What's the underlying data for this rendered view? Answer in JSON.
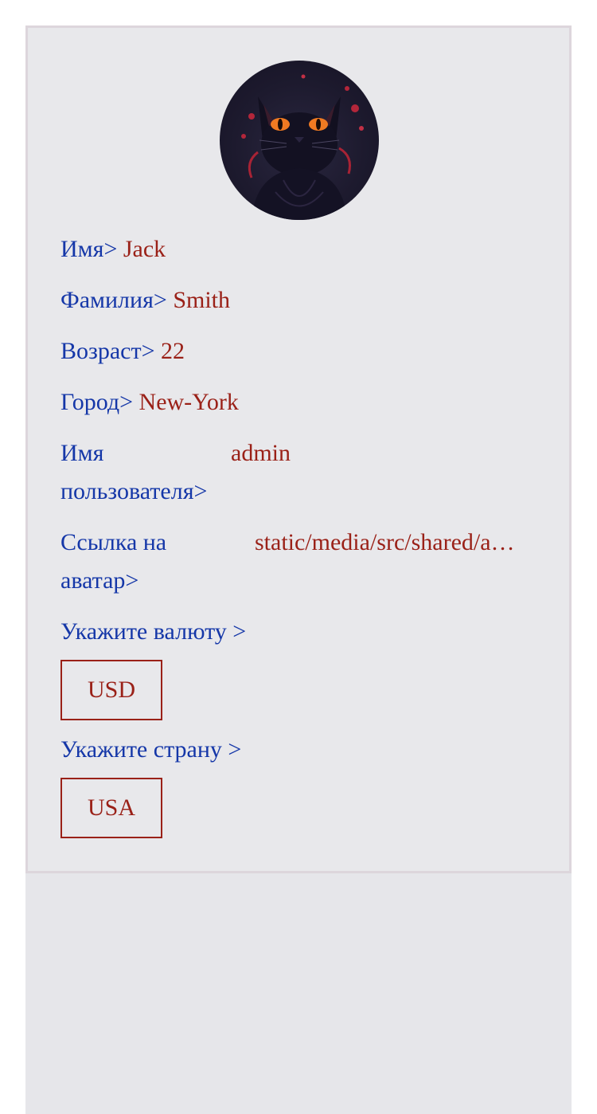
{
  "profile": {
    "first_name_label": "Имя>",
    "first_name": "Jack",
    "last_name_label": "Фамилия>",
    "last_name": "Smith",
    "age_label": "Возраст>",
    "age": "22",
    "city_label": "Город>",
    "city": "New-York",
    "username_label": "Имя пользователя>",
    "username": "admin",
    "avatar_link_label": "Ссылка на аватар>",
    "avatar_link": "static/media/src/shared/a…"
  },
  "currency": {
    "label": "Укажите валюту >",
    "selected": "USD"
  },
  "country": {
    "label": "Укажите страну >",
    "selected": "USA"
  },
  "colors": {
    "label": "#1537a8",
    "value": "#9a2118",
    "card_bg": "#e8e8eb",
    "card_border": "#ddd6dc"
  },
  "icons": {
    "avatar": "black-cat-avatar"
  }
}
